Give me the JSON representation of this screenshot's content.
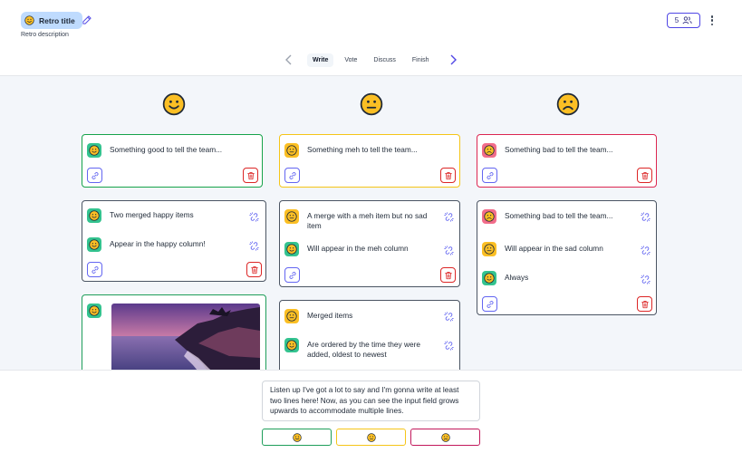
{
  "header": {
    "title": "Retro title",
    "description": "Retro description",
    "participants": "5"
  },
  "steps": [
    {
      "label": "Write",
      "active": true
    },
    {
      "label": "Vote"
    },
    {
      "label": "Discuss"
    },
    {
      "label": "Finish"
    }
  ],
  "columns": {
    "happy": {
      "cards": [
        {
          "items": [
            "Something good to tell the team..."
          ]
        },
        {
          "items": [
            "Two merged happy items",
            "Appear in the happy column!"
          ]
        },
        {
          "items": []
        }
      ]
    },
    "meh": {
      "cards": [
        {
          "items": [
            "Something meh to tell the team..."
          ]
        },
        {
          "items": [
            "A merge with a meh item but no sad item",
            "Will appear in the meh column"
          ]
        },
        {
          "items": [
            "Merged items",
            "Are ordered by the time they were added, oldest to newest"
          ]
        }
      ]
    },
    "sad": {
      "cards": [
        {
          "items": [
            "Something bad to tell the team..."
          ]
        },
        {
          "items": [
            "Something bad to tell the team...",
            "Will appear in the sad column",
            "Always"
          ]
        }
      ]
    }
  },
  "composer": {
    "value": "Listen up I've got a lot to say and I'm gonna write at least two lines here! Now, as you can see the input field grows upwards to accommodate multiple lines."
  },
  "colors": {
    "happy": "#34c38f",
    "meh": "#fbbf24",
    "sad": "#f26d8a",
    "accent": "#4f46e5",
    "danger": "#dc2626"
  },
  "icons": [
    "edit-icon",
    "users-icon",
    "kebab-icon",
    "chevron-left-icon",
    "chevron-right-icon",
    "link-icon",
    "unlink-icon",
    "trash-icon",
    "happy-face-icon",
    "meh-face-icon",
    "sad-face-icon"
  ]
}
